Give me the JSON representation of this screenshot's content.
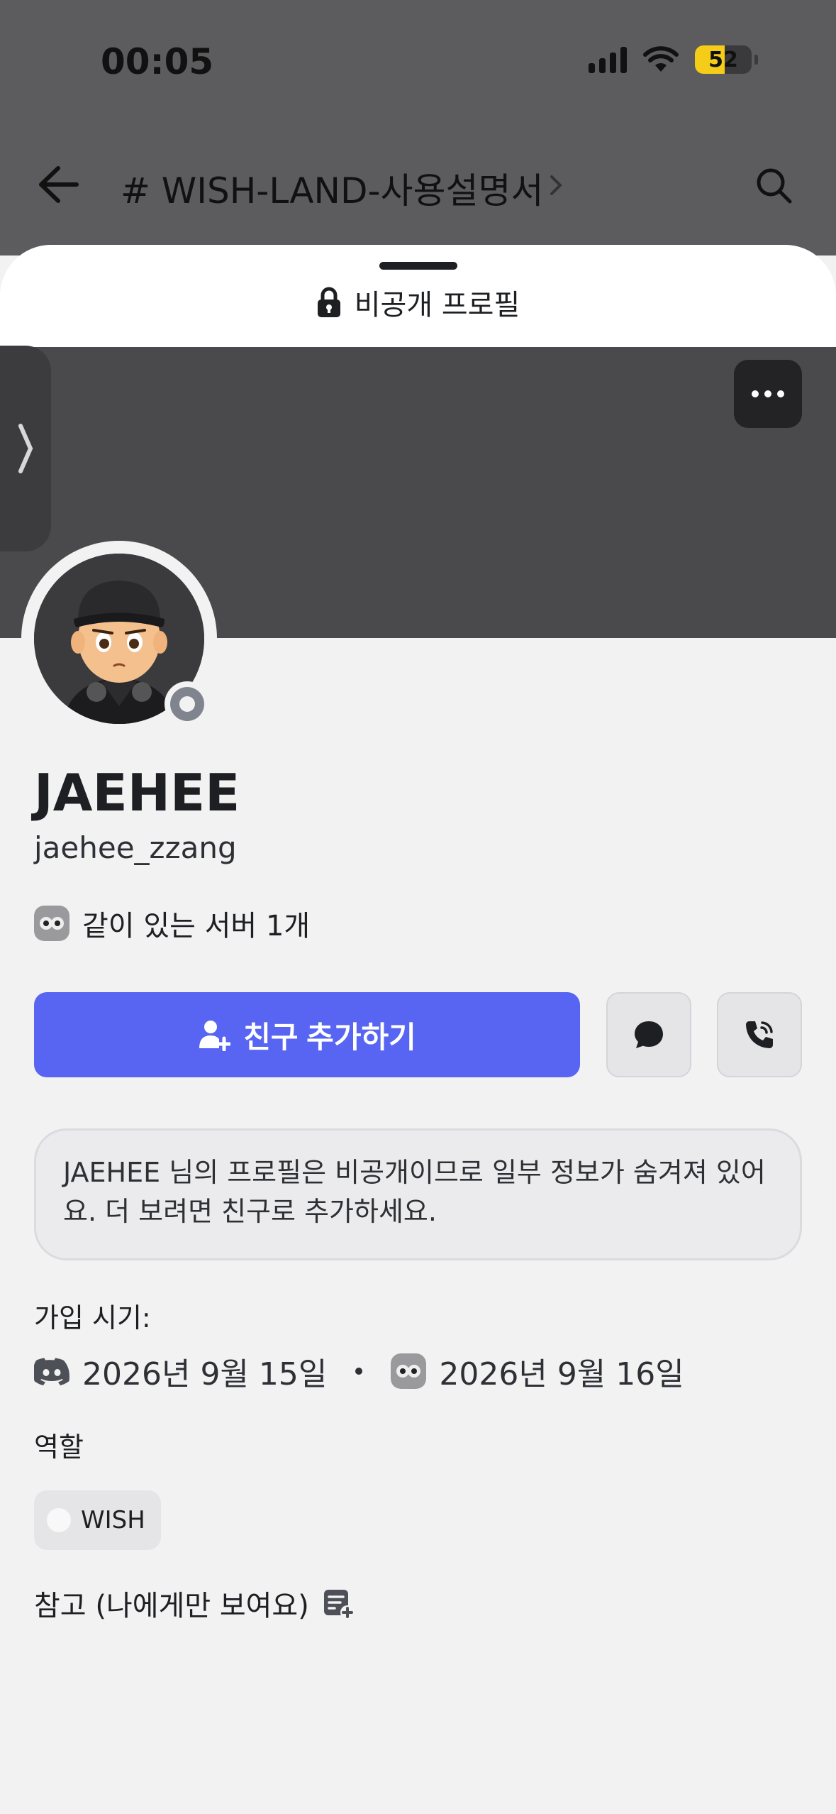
{
  "status_bar": {
    "time": "00:05",
    "battery": "52",
    "battery_level": 0.52
  },
  "background_nav": {
    "channel_title": "# WISH-LAND-사용설명서"
  },
  "sheet": {
    "private_label": "비공개 프로필"
  },
  "profile": {
    "display_name": "JAEHEE",
    "username": "jaehee_zzang",
    "mutual_servers": "같이 있는 서버 1개",
    "status": "offline"
  },
  "actions": {
    "add_friend_label": "친구 추가하기"
  },
  "notice": {
    "text": "JAEHEE 님의 프로필은 비공개이므로 일부 정보가 숨겨져 있어요. 더 보려면 친구로 추가하세요."
  },
  "joined": {
    "label": "가입 시기:",
    "discord_date": "2026년 9월 15일",
    "server_date": "2026년 9월 16일"
  },
  "roles": {
    "label": "역할",
    "items": [
      {
        "name": "WISH",
        "color": "#f8f8f8"
      }
    ]
  },
  "note": {
    "label": "참고 (나에게만 보여요)"
  },
  "colors": {
    "accent": "#5865f2",
    "banner": "#4a4a4c",
    "offline": "#80848e"
  }
}
